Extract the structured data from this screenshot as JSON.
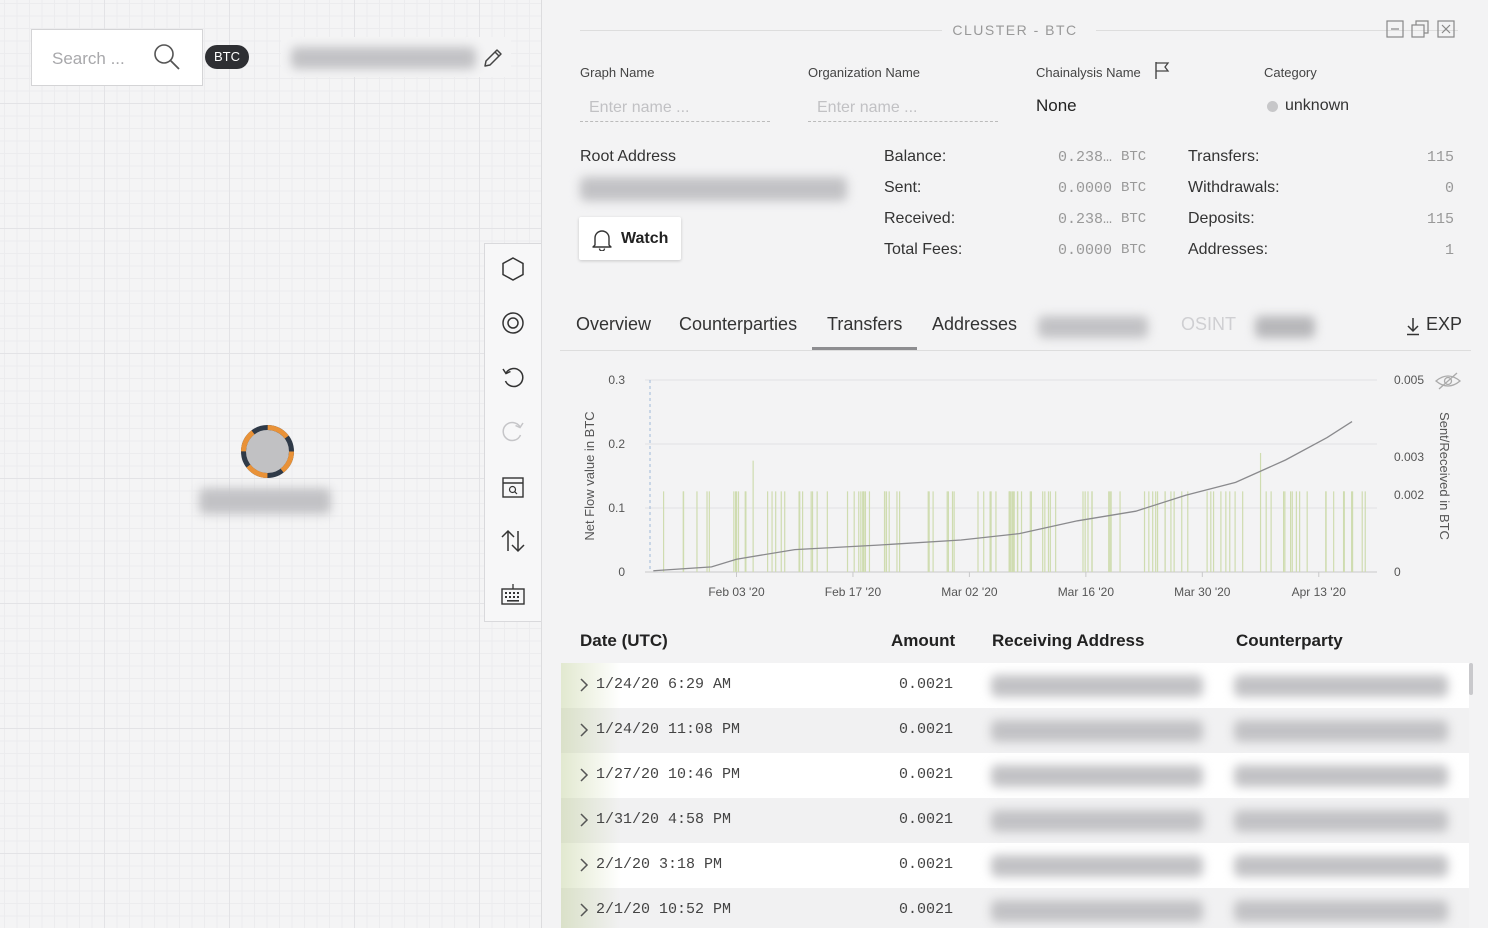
{
  "search": {
    "placeholder": "Search ...",
    "currency": "BTC"
  },
  "tools": [
    "hexagon-icon",
    "target-icon",
    "undo-icon",
    "redo-icon",
    "calendar-search-icon",
    "sort-arrows-icon",
    "keyboard-icon"
  ],
  "panel": {
    "header": "CLUSTER - BTC",
    "fields": {
      "graph_name_label": "Graph Name",
      "graph_name_placeholder": "Enter name ...",
      "org_name_label": "Organization Name",
      "org_name_placeholder": "Enter name ...",
      "chainalysis_label": "Chainalysis Name",
      "chainalysis_value": "None",
      "category_label": "Category",
      "category_value": "unknown"
    },
    "root_address_label": "Root Address",
    "watch_label": "Watch",
    "stats_left": [
      {
        "label": "Balance:",
        "value": "0.238…",
        "unit": "BTC"
      },
      {
        "label": "Sent:",
        "value": "0.0000",
        "unit": "BTC"
      },
      {
        "label": "Received:",
        "value": "0.238…",
        "unit": "BTC"
      },
      {
        "label": "Total Fees:",
        "value": "0.0000",
        "unit": "BTC"
      }
    ],
    "stats_right": [
      {
        "label": "Transfers:",
        "value": "115"
      },
      {
        "label": "Withdrawals:",
        "value": "0"
      },
      {
        "label": "Deposits:",
        "value": "115"
      },
      {
        "label": "Addresses:",
        "value": "1"
      }
    ],
    "tabs": [
      "Overview",
      "Counterparties",
      "Transfers",
      "Addresses",
      "OSINT"
    ],
    "active_tab": "Transfers",
    "export_label": "EXP"
  },
  "chart_data": {
    "type": "line",
    "ylabel": "Net Flow value in BTC",
    "y2label": "Sent/Received in BTC",
    "ylim": [
      0,
      0.3
    ],
    "y_ticks": [
      "0",
      "0.1",
      "0.2",
      "0.3"
    ],
    "y2lim": [
      0,
      0.005
    ],
    "y2_ticks": [
      "0",
      "0.002",
      "0.003",
      "0.005"
    ],
    "x_ticks": [
      "Feb 03 '20",
      "Feb 17 '20",
      "Mar 02 '20",
      "Mar 16 '20",
      "Mar 30 '20",
      "Apr 13 '20"
    ],
    "grid": true,
    "net_flow_series": [
      {
        "x": "2020-01-24",
        "y": 0.002
      },
      {
        "x": "2020-01-31",
        "y": 0.008
      },
      {
        "x": "2020-02-03",
        "y": 0.02
      },
      {
        "x": "2020-02-10",
        "y": 0.035
      },
      {
        "x": "2020-02-20",
        "y": 0.042
      },
      {
        "x": "2020-03-01",
        "y": 0.05
      },
      {
        "x": "2020-03-08",
        "y": 0.06
      },
      {
        "x": "2020-03-15",
        "y": 0.08
      },
      {
        "x": "2020-03-22",
        "y": 0.095
      },
      {
        "x": "2020-03-28",
        "y": 0.12
      },
      {
        "x": "2020-04-03",
        "y": 0.14
      },
      {
        "x": "2020-04-09",
        "y": 0.175
      },
      {
        "x": "2020-04-14",
        "y": 0.21
      },
      {
        "x": "2020-04-17",
        "y": 0.235
      }
    ],
    "bar_series_value": 0.0021,
    "bar_colors": {
      "bar": "#cfdcb0",
      "line": "#8a8a8d"
    }
  },
  "table": {
    "headers": [
      "Date (UTC)",
      "Amount",
      "Receiving Address",
      "Counterparty"
    ],
    "rows": [
      {
        "date": "1/24/20 6:29 AM",
        "amount": "0.0021"
      },
      {
        "date": "1/24/20 11:08 PM",
        "amount": "0.0021"
      },
      {
        "date": "1/27/20 10:46 PM",
        "amount": "0.0021"
      },
      {
        "date": "1/31/20 4:58 PM",
        "amount": "0.0021"
      },
      {
        "date": "2/1/20 3:18 PM",
        "amount": "0.0021"
      },
      {
        "date": "2/1/20 10:52 PM",
        "amount": "0.0021"
      }
    ]
  }
}
